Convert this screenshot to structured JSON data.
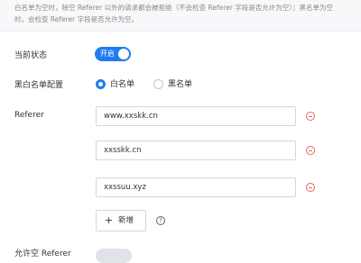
{
  "notice": {
    "line1": "白名单为空时，除空 Referer 以外的请求都会被拒绝（不会检查 Referer 字段是否允许为空）；黑名单为空",
    "line2": "时，会检查 Referer 字段是否允许为空。"
  },
  "status": {
    "label": "当前状态",
    "toggle_text": "开启",
    "enabled": true
  },
  "list_config": {
    "label": "黑白名单配置",
    "options": [
      {
        "label": "白名单",
        "selected": true
      },
      {
        "label": "黑名单",
        "selected": false
      }
    ]
  },
  "referer": {
    "label": "Referer",
    "entries": [
      "www.xxskk.cn",
      "xxsskk.cn",
      "xxssuu.xyz"
    ],
    "add_label": "新增",
    "help_symbol": "?"
  },
  "next_row": {
    "label": "允许空 Referer"
  },
  "colors": {
    "accent": "#1f7cf0",
    "danger": "#e9655a"
  }
}
